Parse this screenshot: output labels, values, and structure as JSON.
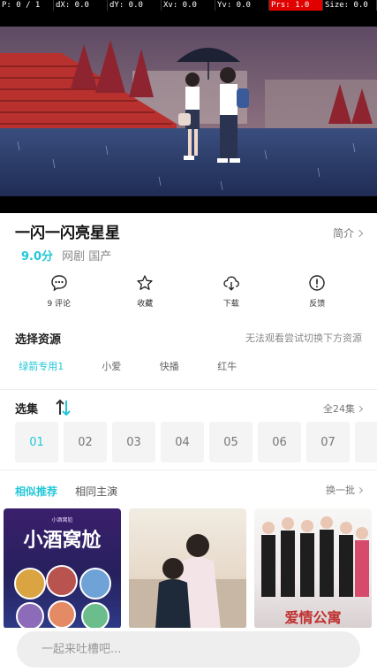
{
  "debug": {
    "p": "P: 0 / 1",
    "dx": "dX: 0.0",
    "dy": "dY: 0.0",
    "xv": "Xv: 0.0",
    "yv": "Yv: 0.0",
    "prs": "Prs: 1.0",
    "size": "Size: 0.0"
  },
  "show": {
    "title": "一闪一闪亮星星",
    "intro_label": "简介",
    "score": "9.0分",
    "meta": "网剧 国产"
  },
  "actions": [
    {
      "label": "9 评论",
      "icon": "comment-icon"
    },
    {
      "label": "收藏",
      "icon": "star-icon"
    },
    {
      "label": "下载",
      "icon": "cloud-download-icon"
    },
    {
      "label": "反馈",
      "icon": "info-icon"
    }
  ],
  "resources": {
    "title": "选择资源",
    "hint": "无法观看尝试切换下方资源",
    "sources": [
      "绿箭专用1",
      "小爱",
      "快播",
      "红牛"
    ],
    "active_index": 0
  },
  "episodes": {
    "title": "选集",
    "all_label": "全24集",
    "items": [
      "01",
      "02",
      "03",
      "04",
      "05",
      "06",
      "07"
    ],
    "active_index": 0
  },
  "recommend": {
    "tabs": [
      "相似推荐",
      "相同主演"
    ],
    "more_label": "换一批",
    "posters": [
      {
        "title": "小酒窝尬",
        "sub": "小酒窝尬"
      },
      {
        "title": "",
        "sub": ""
      },
      {
        "title": "爱情公寓",
        "sub": ""
      }
    ]
  },
  "comment": {
    "placeholder": "一起来吐槽吧..."
  },
  "colors": {
    "accent": "#22c7d8",
    "debug_highlight": "#e00000"
  }
}
